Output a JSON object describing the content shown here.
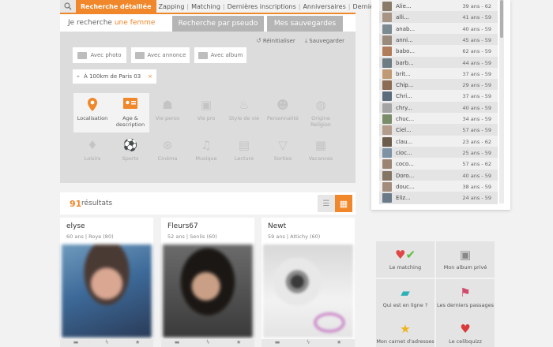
{
  "nav": {
    "active_tab": "Recherche détaillée",
    "links": [
      "Zapping",
      "Matching",
      "Dernières inscriptions",
      "Anniversaires",
      "Derniers passages"
    ]
  },
  "search": {
    "prefix": "Je recherche ",
    "target": "une femme",
    "tab_pseudo": "Recherche par pseudo",
    "tab_saved": "Mes sauvegardes",
    "reset": "Réinitialiser",
    "save": "Sauvegarder",
    "filters": [
      "Avec photo",
      "Avec annonce",
      "Avec album"
    ],
    "location": "À 100km de Paris 03",
    "criteria": [
      {
        "label": "Localisation",
        "icon": "map-pin-icon"
      },
      {
        "label": "Age & description",
        "icon": "id-card-icon"
      },
      {
        "label": "Vie perso",
        "icon": "people-icon"
      },
      {
        "label": "Vie pro",
        "icon": "briefcase-icon"
      },
      {
        "label": "Style de vie",
        "icon": "cake-icon"
      },
      {
        "label": "Personnalité",
        "icon": "head-icon"
      },
      {
        "label": "Origine Religion",
        "icon": "globe-icon"
      },
      {
        "label": "Loisirs",
        "icon": "flame-icon"
      },
      {
        "label": "Sports",
        "icon": "ball-icon"
      },
      {
        "label": "Cinéma",
        "icon": "film-icon"
      },
      {
        "label": "Musique",
        "icon": "music-icon"
      },
      {
        "label": "Lecture",
        "icon": "book-icon"
      },
      {
        "label": "Sorties",
        "icon": "cocktail-icon"
      },
      {
        "label": "Vacances",
        "icon": "suitcase-icon"
      }
    ]
  },
  "results": {
    "count": "91",
    "label": "résultats"
  },
  "profiles": [
    {
      "name": "elyse",
      "age": "60 ans",
      "city": "Roye (80)"
    },
    {
      "name": "Fleurs67",
      "age": "52 ans",
      "city": "Senlis (60)"
    },
    {
      "name": "Newt",
      "age": "59 ans",
      "city": "Attichy (60)"
    }
  ],
  "members": [
    {
      "name": "Alie...",
      "age": "39 ans - 62",
      "color": "#8a7a6a"
    },
    {
      "name": "alli...",
      "age": "41 ans - 59",
      "color": "#a89484"
    },
    {
      "name": "anab...",
      "age": "40 ans - 59",
      "color": "#7c8a92"
    },
    {
      "name": "anni...",
      "age": "45 ans - 59",
      "color": "#9a8a7c"
    },
    {
      "name": "babo...",
      "age": "62 ans - 59",
      "color": "#b07c5c"
    },
    {
      "name": "barb...",
      "age": "44 ans - 59",
      "color": "#6e7c84"
    },
    {
      "name": "brit...",
      "age": "37 ans - 59",
      "color": "#c09a74"
    },
    {
      "name": "Chip...",
      "age": "29 ans - 59",
      "color": "#8c6c54"
    },
    {
      "name": "Chri...",
      "age": "37 ans - 59",
      "color": "#5c6c7c"
    },
    {
      "name": "chry...",
      "age": "40 ans - 59",
      "color": "#a4a4a4"
    },
    {
      "name": "chuc...",
      "age": "34 ans - 59",
      "color": "#7a8c6a"
    },
    {
      "name": "Ciel...",
      "age": "57 ans - 59",
      "color": "#b49c8c"
    },
    {
      "name": "clau...",
      "age": "23 ans - 62",
      "color": "#6c5c4c"
    },
    {
      "name": "cioc...",
      "age": "25 ans - 59",
      "color": "#7e92a6"
    },
    {
      "name": "coco...",
      "age": "57 ans - 62",
      "color": "#9c8474"
    },
    {
      "name": "Doro...",
      "age": "40 ans - 59",
      "color": "#847464"
    },
    {
      "name": "douc...",
      "age": "38 ans - 59",
      "color": "#a48c7c"
    },
    {
      "name": "Eliz...",
      "age": "24 ans - 59",
      "color": "#6a7a8a"
    }
  ],
  "tiles": [
    {
      "label": "Le matching",
      "icon": "hearts-check-icon"
    },
    {
      "label": "Mon album privé",
      "icon": "lock-photo-icon"
    },
    {
      "label": "Qui est en ligne ?",
      "icon": "chat-icon"
    },
    {
      "label": "Les derniers passages",
      "icon": "footsteps-icon"
    },
    {
      "label": "Mon carnet d'adresses",
      "icon": "star-icon"
    },
    {
      "label": "Le celibquizz",
      "icon": "heart-question-icon"
    }
  ],
  "colors": {
    "accent": "#f0872a",
    "panel": "#dcdcdc",
    "tab_gray": "#b5b5b5"
  }
}
